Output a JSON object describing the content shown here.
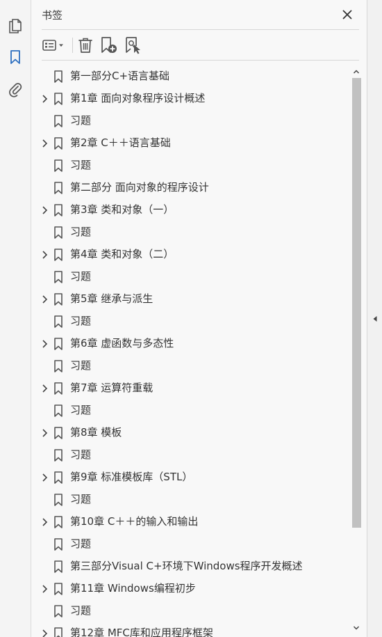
{
  "panel": {
    "title": "书签"
  },
  "rail": {
    "icons": [
      "pages-icon",
      "bookmark-icon",
      "attachment-icon"
    ]
  },
  "toolbar": {
    "icons": [
      "options-menu-icon",
      "delete-bookmark-icon",
      "new-bookmark-icon",
      "bookmark-from-selection-icon"
    ]
  },
  "colors": {
    "accent": "#2d6fc0",
    "icon": "#555555",
    "text": "#333333",
    "scroll_thumb": "#c1c1c1"
  },
  "bookmarks": [
    {
      "label": "第一部分C+语言基础",
      "expandable": false
    },
    {
      "label": "第1章 面向对象程序设计概述",
      "expandable": true
    },
    {
      "label": "习题",
      "expandable": false
    },
    {
      "label": "第2章 C＋＋语言基础",
      "expandable": true
    },
    {
      "label": "习题",
      "expandable": false
    },
    {
      "label": "第二部分 面向对象的程序设计",
      "expandable": false
    },
    {
      "label": "第3章 类和对象（一）",
      "expandable": true
    },
    {
      "label": "习题",
      "expandable": false
    },
    {
      "label": "第4章 类和对象（二）",
      "expandable": true
    },
    {
      "label": "习题",
      "expandable": false
    },
    {
      "label": "第5章 继承与派生",
      "expandable": true
    },
    {
      "label": "习题",
      "expandable": false
    },
    {
      "label": "第6章 虚函数与多态性",
      "expandable": true
    },
    {
      "label": "习题",
      "expandable": false
    },
    {
      "label": "第7章 运算符重载",
      "expandable": true
    },
    {
      "label": "习题",
      "expandable": false
    },
    {
      "label": "第8章 模板",
      "expandable": true
    },
    {
      "label": "习题",
      "expandable": false
    },
    {
      "label": "第9章 标准模板库（STL）",
      "expandable": true
    },
    {
      "label": "习题",
      "expandable": false
    },
    {
      "label": "第10章 C＋＋的输入和输出",
      "expandable": true
    },
    {
      "label": "习题",
      "expandable": false
    },
    {
      "label": "第三部分Visual C+环境下Windows程序开发概述",
      "expandable": false
    },
    {
      "label": "第11章 Windows编程初步",
      "expandable": true
    },
    {
      "label": "习题",
      "expandable": false
    },
    {
      "label": "第12章 MFC库和应用程序框架",
      "expandable": true
    }
  ]
}
